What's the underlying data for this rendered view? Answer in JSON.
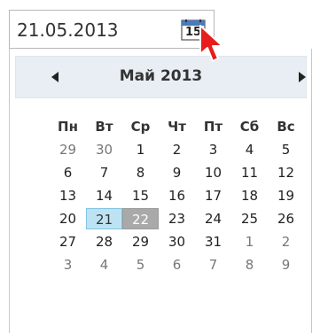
{
  "date_input": {
    "value": "21.05.2013",
    "calendar_icon_day": "15",
    "calendar_icon": "calendar-icon"
  },
  "calendar": {
    "month_title": "Май 2013",
    "prev_icon": "triangle-left-icon",
    "next_icon": "triangle-right-icon",
    "weekdays": [
      "Пн",
      "Вт",
      "Ср",
      "Чт",
      "Пт",
      "Сб",
      "Вс"
    ],
    "weeks": [
      [
        "29",
        "30",
        "1",
        "2",
        "3",
        "4",
        "5"
      ],
      [
        "6",
        "7",
        "8",
        "9",
        "10",
        "11",
        "12"
      ],
      [
        "13",
        "14",
        "15",
        "16",
        "17",
        "18",
        "19"
      ],
      [
        "20",
        "21",
        "22",
        "23",
        "24",
        "25",
        "26"
      ],
      [
        "27",
        "28",
        "29",
        "30",
        "31",
        "1",
        "2"
      ],
      [
        "3",
        "4",
        "5",
        "6",
        "7",
        "8",
        "9"
      ]
    ],
    "today_day": "21",
    "selected_day": "22"
  },
  "colors": {
    "today_bg": "#bde3f3",
    "selected_bg": "#a9a9a9",
    "header_bg": "#e8eef4",
    "cursor": "#e81c1c"
  }
}
